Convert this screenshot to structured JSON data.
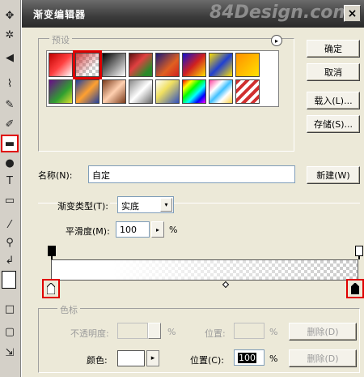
{
  "dialog": {
    "title": "渐变编辑器",
    "watermark": "84Design.com",
    "close_glyph": "×"
  },
  "toolbox": {
    "tools": [
      {
        "name": "move-tool-icon",
        "glyph": "✥"
      },
      {
        "name": "magic-wand-tool-icon",
        "glyph": "✲"
      },
      {
        "name": "healing-brush-tool-icon",
        "glyph": "⌇"
      },
      {
        "name": "brush-tool-icon",
        "glyph": "✎"
      },
      {
        "name": "history-brush-tool-icon",
        "glyph": "✐"
      },
      {
        "name": "gradient-tool-icon",
        "glyph": "▬",
        "selected": true
      },
      {
        "name": "burn-tool-icon",
        "glyph": "●"
      },
      {
        "name": "type-tool-icon",
        "glyph": "T"
      },
      {
        "name": "shape-tool-icon",
        "glyph": "▭"
      },
      {
        "name": "eyedropper-tool-icon",
        "glyph": "⁄"
      },
      {
        "name": "zoom-tool-icon",
        "glyph": "⚲"
      },
      {
        "name": "swap-colors-icon",
        "glyph": "↲"
      }
    ]
  },
  "presets": {
    "label": "预设",
    "menu_glyph": "▸",
    "swatches": [
      {
        "kind": "gradient",
        "css": "linear-gradient(135deg,#c00000,#ff4040 50%,#fff)"
      },
      {
        "kind": "fg-to-transparent",
        "css": "",
        "selected": true
      },
      {
        "kind": "gradient",
        "css": "linear-gradient(135deg,#000,#fff)"
      },
      {
        "kind": "gradient",
        "css": "linear-gradient(135deg,#5a1010,#e04040 40%,#2a8a2a 80%)"
      },
      {
        "kind": "gradient",
        "css": "linear-gradient(135deg,#1a1a7a,#e06020 60%,#d02020)"
      },
      {
        "kind": "gradient",
        "css": "linear-gradient(135deg,#1010d0,#d02020 50%,#ffe000)"
      },
      {
        "kind": "gradient",
        "css": "linear-gradient(135deg,#ffe000,#2040d0 50%,#ffe000)"
      },
      {
        "kind": "gradient",
        "css": "linear-gradient(135deg,#ff9000,#ffe000)"
      },
      {
        "kind": "gradient",
        "css": "linear-gradient(135deg,#6a0a8a,#30a030 60%,#e0e030)"
      },
      {
        "kind": "gradient",
        "css": "linear-gradient(135deg,#2040a0,#ffa030 50%,#2040a0)"
      },
      {
        "kind": "gradient",
        "css": "linear-gradient(135deg,#7a3a1a,#ffd0b0 50%,#7a3a1a)"
      },
      {
        "kind": "gradient",
        "css": "linear-gradient(135deg,#8a8a8a,#fff 50%,#6a6a6a)"
      },
      {
        "kind": "gradient",
        "css": "linear-gradient(135deg,#fff,#f0e060 40%,#3050c0)"
      },
      {
        "kind": "gradient",
        "css": "linear-gradient(135deg,#ff0000,#ffff00 20%,#00ff00 40%,#00ffff 60%,#0000ff 80%,#ff00ff)"
      },
      {
        "kind": "gradient",
        "css": "linear-gradient(135deg,#ff40a0,#fff 30%,#40c0ff 50%,#fff 70%,#ffd040)"
      },
      {
        "kind": "gradient",
        "css": "repeating-linear-gradient(135deg,#d03030 0 4px,#fff 4px 8px)"
      }
    ]
  },
  "buttons": {
    "ok": "确定",
    "cancel": "取消",
    "load": "载入(L)...",
    "save": "存储(S)...",
    "new": "新建(W)",
    "delete_opacity": "删除(D)",
    "delete_color": "删除(D)"
  },
  "name_row": {
    "label": "名称(N):",
    "value": "自定"
  },
  "gradient_type": {
    "label": "渐变类型(T):",
    "value": "实底",
    "arrow": "▾"
  },
  "smoothness": {
    "label": "平滑度(M):",
    "value": "100",
    "unit": "%",
    "spin_glyph": "▸"
  },
  "color_stops": {
    "group_label": "色标",
    "opacity_label": "不透明度:",
    "opacity_value": "",
    "opacity_unit": "%",
    "opacity_location_label": "位置:",
    "opacity_location_value": "",
    "opacity_location_unit": "%",
    "color_label": "颜色:",
    "color_arrow": "▸",
    "color_location_label": "位置(C):",
    "color_location_value": "100",
    "color_location_unit": "%"
  }
}
